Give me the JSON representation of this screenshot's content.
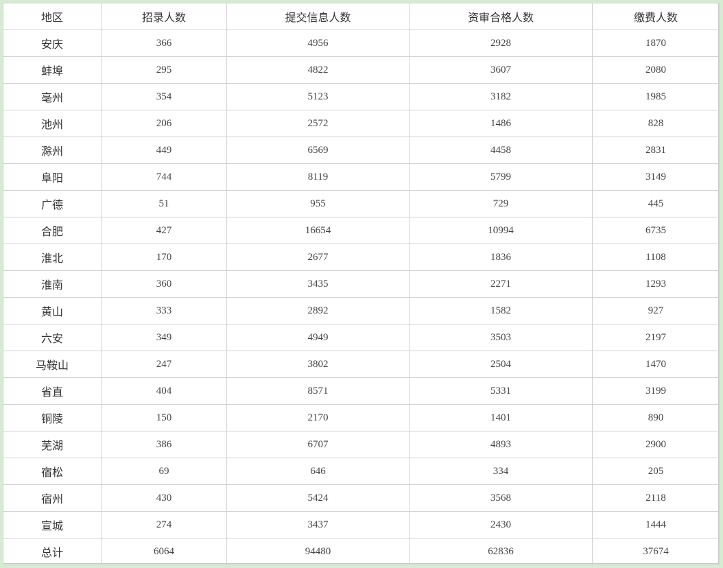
{
  "table": {
    "headers": [
      "地区",
      "招录人数",
      "提交信息人数",
      "资审合格人数",
      "缴费人数"
    ],
    "rows": [
      [
        "安庆",
        "366",
        "4956",
        "2928",
        "1870"
      ],
      [
        "蚌埠",
        "295",
        "4822",
        "3607",
        "2080"
      ],
      [
        "亳州",
        "354",
        "5123",
        "3182",
        "1985"
      ],
      [
        "池州",
        "206",
        "2572",
        "1486",
        "828"
      ],
      [
        "滁州",
        "449",
        "6569",
        "4458",
        "2831"
      ],
      [
        "阜阳",
        "744",
        "8119",
        "5799",
        "3149"
      ],
      [
        "广德",
        "51",
        "955",
        "729",
        "445"
      ],
      [
        "合肥",
        "427",
        "16654",
        "10994",
        "6735"
      ],
      [
        "淮北",
        "170",
        "2677",
        "1836",
        "1108"
      ],
      [
        "淮南",
        "360",
        "3435",
        "2271",
        "1293"
      ],
      [
        "黄山",
        "333",
        "2892",
        "1582",
        "927"
      ],
      [
        "六安",
        "349",
        "4949",
        "3503",
        "2197"
      ],
      [
        "马鞍山",
        "247",
        "3802",
        "2504",
        "1470"
      ],
      [
        "省直",
        "404",
        "8571",
        "5331",
        "3199"
      ],
      [
        "铜陵",
        "150",
        "2170",
        "1401",
        "890"
      ],
      [
        "芜湖",
        "386",
        "6707",
        "4893",
        "2900"
      ],
      [
        "宿松",
        "69",
        "646",
        "334",
        "205"
      ],
      [
        "宿州",
        "430",
        "5424",
        "3568",
        "2118"
      ],
      [
        "宣城",
        "274",
        "3437",
        "2430",
        "1444"
      ],
      [
        "总计",
        "6064",
        "94480",
        "62836",
        "37674"
      ]
    ]
  }
}
